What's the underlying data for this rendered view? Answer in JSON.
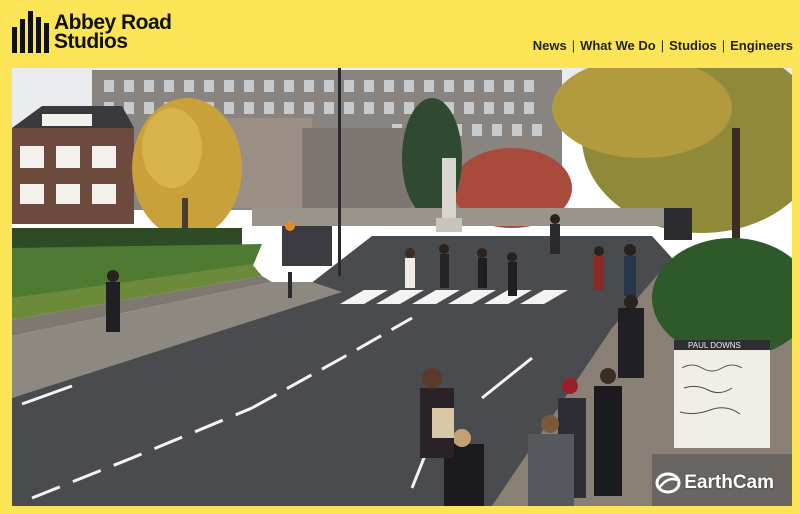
{
  "header": {
    "logo_line1": "Abbey Road",
    "logo_line2": "Studios",
    "nav": [
      {
        "label": "News"
      },
      {
        "label": "What We Do"
      },
      {
        "label": "Studios"
      },
      {
        "label": "Engineers"
      }
    ]
  },
  "webcam": {
    "watermark": "EarthCam",
    "sign_text": "PAUL DOWNS"
  },
  "colors": {
    "brand_yellow": "#fbe556",
    "road": "#4a4b4e",
    "sidewalk": "#8d8880"
  }
}
